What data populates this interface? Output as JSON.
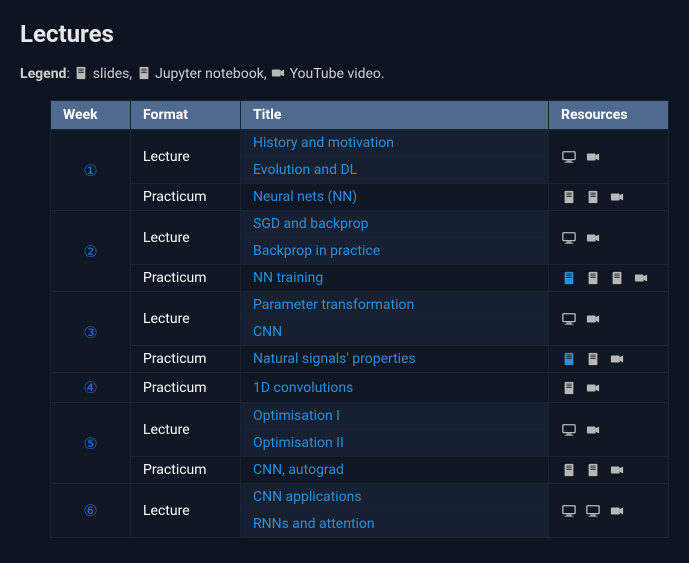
{
  "heading": "Lectures",
  "legend": {
    "label": "Legend",
    "slides": "slides,",
    "notebook": "Jupyter notebook,",
    "video": "YouTube video."
  },
  "headers": {
    "week": "Week",
    "format": "Format",
    "title": "Title",
    "resources": "Resources"
  },
  "weeks": [
    {
      "num": "①",
      "rows": [
        {
          "format": "Lecture",
          "fspan": 2,
          "title": "History and motivation",
          "shade": "light",
          "res": [
            "monitor",
            "camera"
          ],
          "rspan": 2
        },
        {
          "title": "Evolution and DL",
          "shade": "light"
        },
        {
          "format": "Practicum",
          "fspan": 1,
          "title": "Neural nets (NN)",
          "shade": "dark",
          "res": [
            "doc",
            "doc",
            "camera"
          ],
          "rspan": 1
        }
      ]
    },
    {
      "num": "②",
      "rows": [
        {
          "format": "Lecture",
          "fspan": 2,
          "title": "SGD and backprop",
          "shade": "light",
          "res": [
            "monitor",
            "camera"
          ],
          "rspan": 2
        },
        {
          "title": "Backprop in practice",
          "shade": "light"
        },
        {
          "format": "Practicum",
          "fspan": 1,
          "title": "NN training",
          "shade": "dark",
          "res": [
            "doc-blue",
            "doc",
            "doc",
            "camera"
          ],
          "rspan": 1
        }
      ]
    },
    {
      "num": "③",
      "rows": [
        {
          "format": "Lecture",
          "fspan": 2,
          "title": "Parameter transformation",
          "shade": "light",
          "res": [
            "monitor",
            "camera"
          ],
          "rspan": 2
        },
        {
          "title": "CNN",
          "shade": "light"
        },
        {
          "format": "Practicum",
          "fspan": 1,
          "title": "Natural signals' properties",
          "shade": "dark",
          "res": [
            "doc-blue",
            "doc",
            "camera"
          ],
          "rspan": 1
        }
      ]
    },
    {
      "num": "④",
      "rows": [
        {
          "format": "Practicum",
          "fspan": 1,
          "title": "1D convolutions",
          "shade": "dark",
          "res": [
            "doc",
            "camera"
          ],
          "rspan": 1
        }
      ]
    },
    {
      "num": "⑤",
      "rows": [
        {
          "format": "Lecture",
          "fspan": 2,
          "title": "Optimisation I",
          "shade": "light",
          "res": [
            "monitor",
            "camera"
          ],
          "rspan": 2
        },
        {
          "title": "Optimisation II",
          "shade": "light"
        },
        {
          "format": "Practicum",
          "fspan": 1,
          "title": "CNN, autograd",
          "shade": "dark",
          "res": [
            "doc",
            "doc",
            "camera"
          ],
          "rspan": 1
        }
      ]
    },
    {
      "num": "⑥",
      "rows": [
        {
          "format": "Lecture",
          "fspan": 2,
          "title": "CNN applications",
          "shade": "light",
          "res": [
            "monitor",
            "monitor",
            "camera"
          ],
          "rspan": 2
        },
        {
          "title": "RNNs and attention",
          "shade": "light"
        }
      ]
    }
  ]
}
